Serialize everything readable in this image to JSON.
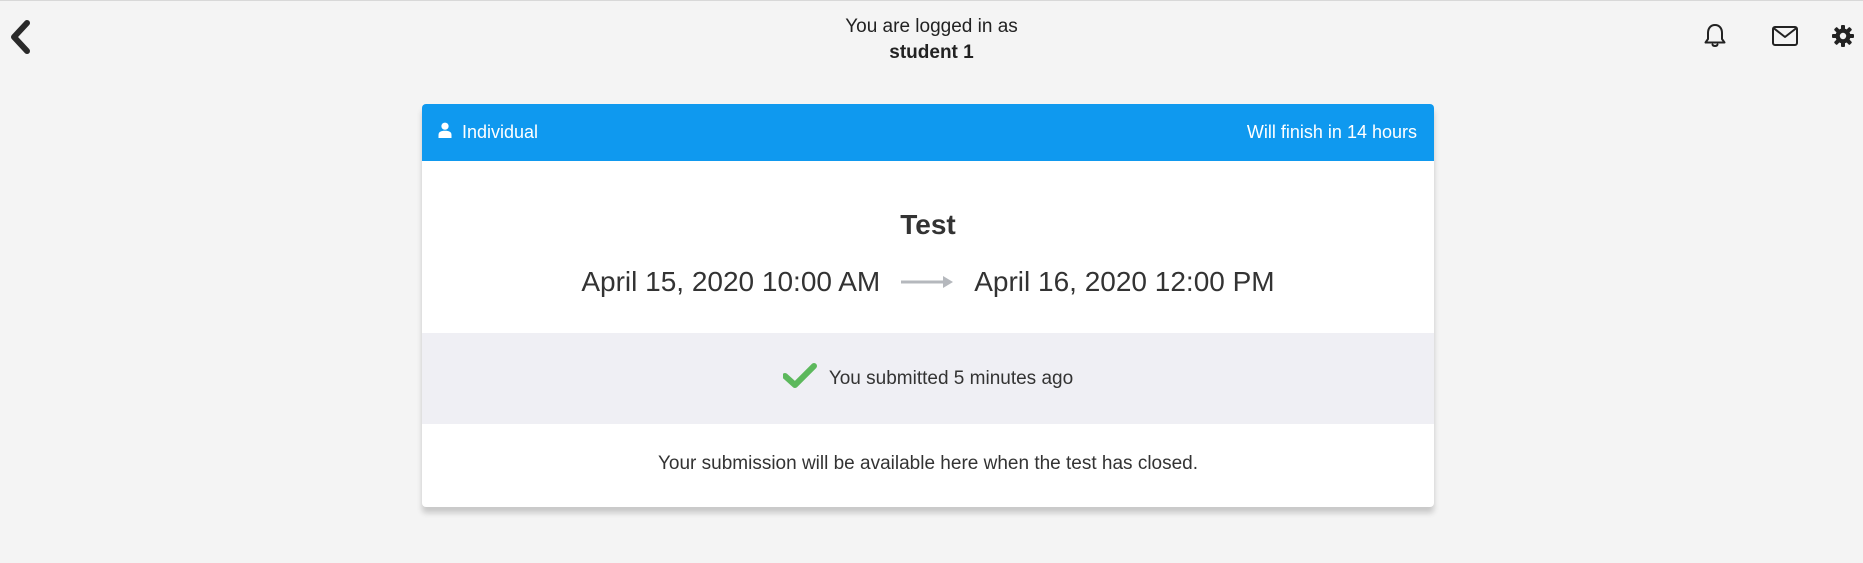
{
  "header": {
    "login_prefix": "You are logged in as",
    "user_name": "student 1",
    "icons": [
      "back-chevron-icon",
      "bell-icon",
      "envelope-icon",
      "gear-icon"
    ]
  },
  "card": {
    "mode_label": "Individual",
    "mode_icon": "user-icon",
    "status_text": "Will finish in 14 hours",
    "accent_color": "#0f99ef",
    "title": "Test",
    "start_date": "April 15, 2020 10:00 AM",
    "end_date": "April 16, 2020 12:00 PM",
    "submitted_text": "You submitted 5 minutes ago",
    "submitted_icon": "checkmark-icon",
    "success_color": "#5cb85c",
    "availability_text": "Your submission will be available here when the test has closed."
  }
}
